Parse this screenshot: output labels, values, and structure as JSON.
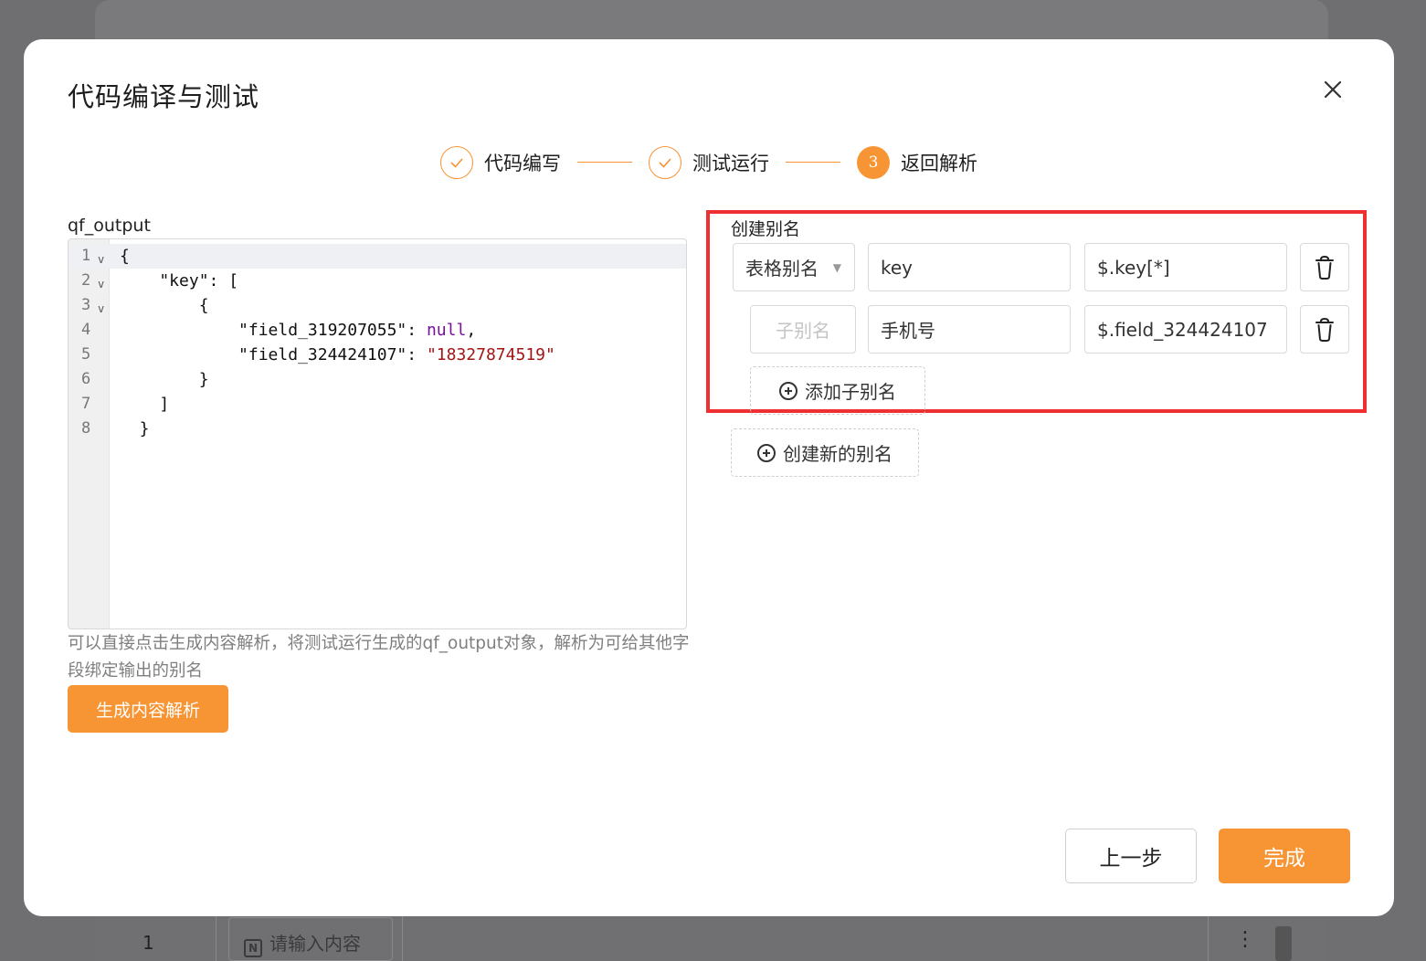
{
  "background": {
    "row_number": "1",
    "input_placeholder": "请输入内容"
  },
  "modal": {
    "title": "代码编译与测试"
  },
  "steps": [
    {
      "label": "代码编写",
      "state": "done",
      "icon": "check-icon"
    },
    {
      "label": "测试运行",
      "state": "done",
      "icon": "check-icon"
    },
    {
      "label": "返回解析",
      "state": "active",
      "number": "3"
    }
  ],
  "editor": {
    "label": "qf_output",
    "lines": [
      {
        "n": "1",
        "fold": true,
        "segments": [
          {
            "t": "{",
            "c": ""
          }
        ]
      },
      {
        "n": "2",
        "fold": true,
        "segments": [
          {
            "t": "    \"key\": [",
            "c": ""
          }
        ]
      },
      {
        "n": "3",
        "fold": true,
        "segments": [
          {
            "t": "        {",
            "c": ""
          }
        ]
      },
      {
        "n": "4",
        "fold": false,
        "segments": [
          {
            "t": "            \"field_319207055\": ",
            "c": ""
          },
          {
            "t": "null",
            "c": "tok-null"
          },
          {
            "t": ",",
            "c": ""
          }
        ]
      },
      {
        "n": "5",
        "fold": false,
        "segments": [
          {
            "t": "            \"field_324424107\": ",
            "c": ""
          },
          {
            "t": "\"18327874519\"",
            "c": "tok-str"
          }
        ]
      },
      {
        "n": "6",
        "fold": false,
        "segments": [
          {
            "t": "        }",
            "c": ""
          }
        ]
      },
      {
        "n": "7",
        "fold": false,
        "segments": [
          {
            "t": "    ]",
            "c": ""
          }
        ]
      },
      {
        "n": "8",
        "fold": false,
        "segments": [
          {
            "t": "  }",
            "c": ""
          }
        ]
      }
    ]
  },
  "hint": "可以直接点击生成内容解析，将测试运行生成的qf_output对象，解析为可给其他字段绑定输出的别名",
  "generate_button": "生成内容解析",
  "alias": {
    "title": "创建别名",
    "row1": {
      "type": "表格别名",
      "name": "key",
      "path": "$.key[*]"
    },
    "row2": {
      "type_placeholder": "子别名",
      "name": "手机号",
      "path": "$.field_324424107"
    },
    "add_child": "添加子别名",
    "create_new": "创建新的别名"
  },
  "footer": {
    "prev": "上一步",
    "finish": "完成"
  },
  "colors": {
    "accent": "#f79433",
    "highlight": "#ee3033"
  }
}
